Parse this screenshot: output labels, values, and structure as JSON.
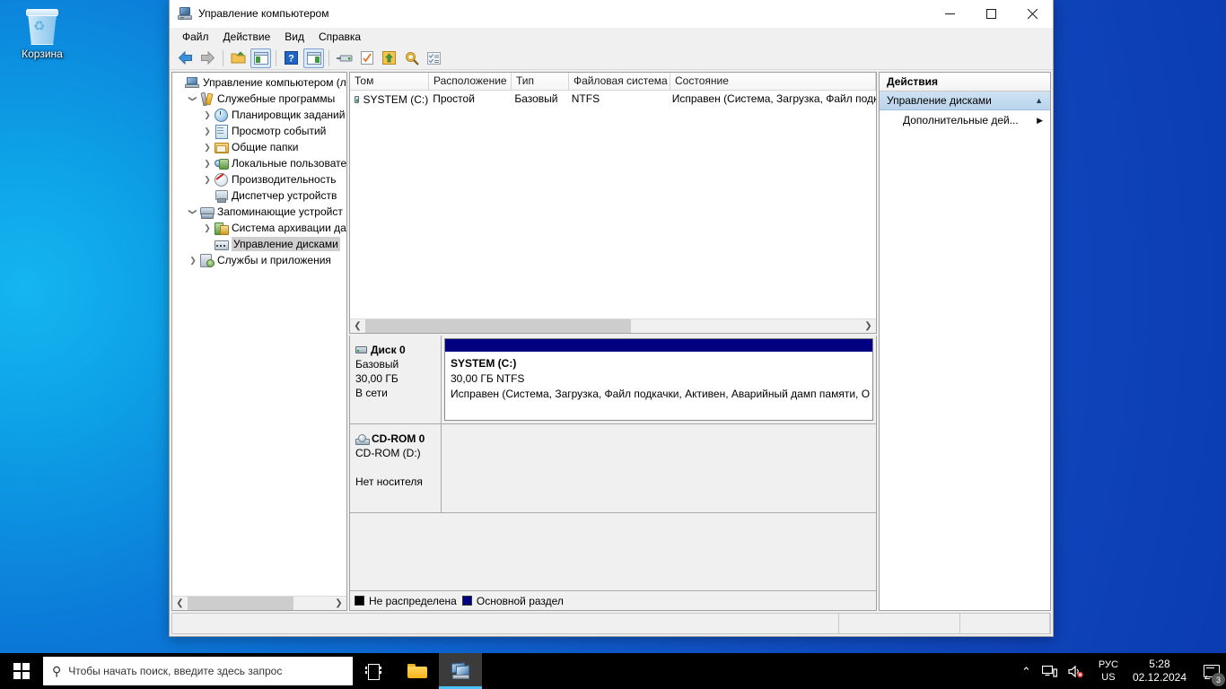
{
  "desktop": {
    "icons": [
      {
        "name": "recycle-bin",
        "label": "Корзина"
      }
    ]
  },
  "window": {
    "title": "Управление компьютером",
    "icon": "computer-management-icon",
    "controls": {
      "minimize": "—",
      "maximize": "□",
      "close": "✕"
    },
    "menus": [
      "Файл",
      "Действие",
      "Вид",
      "Справка"
    ],
    "toolbar": [
      {
        "name": "back-button",
        "icon": "arrow-left-icon"
      },
      {
        "name": "forward-button",
        "icon": "arrow-right-icon"
      },
      {
        "name": "up-folder-button",
        "icon": "folder-up-icon"
      },
      {
        "name": "show-hide-tree-button",
        "icon": "show-tree-icon",
        "checked": true
      },
      {
        "name": "help-button",
        "icon": "help-icon"
      },
      {
        "name": "show-action-pane-button",
        "icon": "action-pane-icon",
        "checked": true
      },
      {
        "name": "rescan-disks-button",
        "icon": "disk-icon"
      },
      {
        "name": "properties-button",
        "icon": "checklist-icon"
      },
      {
        "name": "export-list-button",
        "icon": "export-up-icon"
      },
      {
        "name": "search-button",
        "icon": "magnifier-icon"
      },
      {
        "name": "details-button",
        "icon": "details-list-icon"
      }
    ]
  },
  "tree": {
    "nodes": [
      {
        "label": "Управление компьютером (л",
        "icon": "computer-icon",
        "indent": 0,
        "twist": "",
        "selected": false
      },
      {
        "label": "Служебные программы",
        "icon": "tools-icon",
        "indent": 1,
        "twist": "v",
        "selected": false
      },
      {
        "label": "Планировщик заданий",
        "icon": "clock-icon",
        "indent": 2,
        "twist": ">",
        "selected": false
      },
      {
        "label": "Просмотр событий",
        "icon": "event-viewer-icon",
        "indent": 2,
        "twist": ">",
        "selected": false
      },
      {
        "label": "Общие папки",
        "icon": "shared-folders-icon",
        "indent": 2,
        "twist": ">",
        "selected": false
      },
      {
        "label": "Локальные пользовате",
        "icon": "users-icon",
        "indent": 2,
        "twist": ">",
        "selected": false
      },
      {
        "label": "Производительность",
        "icon": "performance-icon",
        "indent": 2,
        "twist": ">",
        "selected": false
      },
      {
        "label": "Диспетчер устройств",
        "icon": "device-manager-icon",
        "indent": 2,
        "twist": "",
        "selected": false
      },
      {
        "label": "Запоминающие устройст",
        "icon": "storage-icon",
        "indent": 1,
        "twist": "v",
        "selected": false
      },
      {
        "label": "Система архивации да",
        "icon": "backup-icon",
        "indent": 2,
        "twist": ">",
        "selected": false
      },
      {
        "label": "Управление дисками",
        "icon": "disk-management-icon",
        "indent": 2,
        "twist": "",
        "selected": true
      },
      {
        "label": "Службы и приложения",
        "icon": "services-icon",
        "indent": 1,
        "twist": ">",
        "selected": false
      }
    ]
  },
  "volumes": {
    "columns": [
      "Том",
      "Расположение",
      "Тип",
      "Файловая система",
      "Состояние"
    ],
    "rows": [
      {
        "volume": "SYSTEM (C:)",
        "layout": "Простой",
        "type": "Базовый",
        "filesystem": "NTFS",
        "status": "Исправен (Система, Загрузка, Файл подк"
      }
    ]
  },
  "disks": [
    {
      "name": "Диск 0",
      "icon": "hard-disk-icon",
      "type": "Базовый",
      "size": "30,00 ГБ",
      "state": "В сети",
      "partition": {
        "label": "SYSTEM  (C:)",
        "size": "30,00 ГБ NTFS",
        "status": "Исправен (Система, Загрузка, Файл подкачки, Активен, Аварийный дамп памяти, О",
        "bar_color": "#000080"
      }
    },
    {
      "name": "CD-ROM 0",
      "icon": "cdrom-icon",
      "type": "CD-ROM (D:)",
      "size": "",
      "state": "Нет носителя",
      "partition": null
    }
  ],
  "legend": [
    {
      "label": "Не распределена",
      "color": "#000000"
    },
    {
      "label": "Основной раздел",
      "color": "#000080"
    }
  ],
  "actions": {
    "title": "Действия",
    "groups": [
      {
        "name": "Управление дисками",
        "chevron": "▲",
        "items": [
          {
            "label": "Дополнительные дей...",
            "chevron": "▶"
          }
        ]
      }
    ]
  },
  "statusbar": {
    "main": "",
    "segment_a": "",
    "segment_b": ""
  },
  "taskbar": {
    "start": "start-button",
    "search_placeholder": "Чтобы начать поиск, введите здесь запрос",
    "search_icon": "search-icon",
    "buttons": [
      {
        "name": "task-view-button",
        "icon": "task-view-icon",
        "active": false
      },
      {
        "name": "file-explorer-button",
        "icon": "folder-icon",
        "active": false
      },
      {
        "name": "computer-management-taskbar-button",
        "icon": "computer-management-icon",
        "active": true
      }
    ],
    "tray": {
      "chevron": "⌃",
      "network_icon": "network-icon",
      "volume_icon": "volume-muted-icon",
      "lang_top": "РУС",
      "lang_bottom": "US",
      "time": "5:28",
      "date": "02.12.2024",
      "notifications_icon": "notification-icon",
      "notifications_count": "3"
    }
  }
}
